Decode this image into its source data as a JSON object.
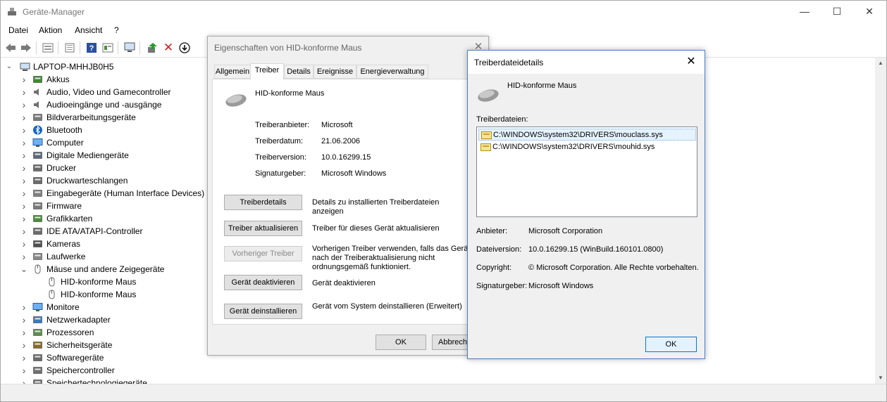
{
  "main": {
    "title": "Geräte-Manager",
    "menu": [
      "Datei",
      "Aktion",
      "Ansicht",
      "?"
    ],
    "window_buttons": {
      "minimize": "—",
      "maximize": "☐",
      "close": "✕"
    },
    "tree": {
      "root": "LAPTOP-MHHJB0H5",
      "items": [
        {
          "label": "Akkus",
          "icon": "battery-icon",
          "expanded": false
        },
        {
          "label": "Audio, Video und Gamecontroller",
          "icon": "speaker-icon",
          "expanded": false
        },
        {
          "label": "Audioeingänge und -ausgänge",
          "icon": "speaker-icon",
          "expanded": false
        },
        {
          "label": "Bildverarbeitungsgeräte",
          "icon": "camera-icon",
          "expanded": false
        },
        {
          "label": "Bluetooth",
          "icon": "bluetooth-icon",
          "expanded": false
        },
        {
          "label": "Computer",
          "icon": "monitor-icon",
          "expanded": false
        },
        {
          "label": "Digitale Mediengeräte",
          "icon": "media-icon",
          "expanded": false
        },
        {
          "label": "Drucker",
          "icon": "printer-icon",
          "expanded": false
        },
        {
          "label": "Druckwarteschlangen",
          "icon": "printer-icon",
          "expanded": false
        },
        {
          "label": "Eingabegeräte (Human Interface Devices)",
          "icon": "hid-icon",
          "expanded": false
        },
        {
          "label": "Firmware",
          "icon": "chip-icon",
          "expanded": false
        },
        {
          "label": "Grafikkarten",
          "icon": "display-adapter-icon",
          "expanded": false
        },
        {
          "label": "IDE ATA/ATAPI-Controller",
          "icon": "controller-icon",
          "expanded": false
        },
        {
          "label": "Kameras",
          "icon": "webcam-icon",
          "expanded": false
        },
        {
          "label": "Laufwerke",
          "icon": "drive-icon",
          "expanded": false
        },
        {
          "label": "Mäuse und andere Zeigegeräte",
          "icon": "mouse-icon",
          "expanded": true
        },
        {
          "label": "HID-konforme Maus",
          "icon": "mouse-icon",
          "child": true
        },
        {
          "label": "HID-konforme Maus",
          "icon": "mouse-icon",
          "child": true
        },
        {
          "label": "Monitore",
          "icon": "monitor-icon",
          "expanded": false
        },
        {
          "label": "Netzwerkadapter",
          "icon": "network-icon",
          "expanded": false
        },
        {
          "label": "Prozessoren",
          "icon": "cpu-icon",
          "expanded": false
        },
        {
          "label": "Sicherheitsgeräte",
          "icon": "security-icon",
          "expanded": false
        },
        {
          "label": "Softwaregeräte",
          "icon": "software-icon",
          "expanded": false
        },
        {
          "label": "Speichercontroller",
          "icon": "storage-icon",
          "expanded": false
        },
        {
          "label": "Speichertechnologiegeräte",
          "icon": "storage-icon",
          "expanded": false
        }
      ]
    }
  },
  "properties": {
    "title": "Eigenschaften von HID-konforme Maus",
    "tabs": [
      "Allgemein",
      "Treiber",
      "Details",
      "Ereignisse",
      "Energieverwaltung"
    ],
    "active_tab": "Treiber",
    "device_name": "HID-konforme Maus",
    "fields": [
      {
        "label": "Treiberanbieter:",
        "value": "Microsoft"
      },
      {
        "label": "Treiberdatum:",
        "value": "21.06.2006"
      },
      {
        "label": "Treiberversion:",
        "value": "10.0.16299.15"
      },
      {
        "label": "Signaturgeber:",
        "value": "Microsoft Windows"
      }
    ],
    "actions": [
      {
        "button": "Treiberdetails",
        "desc": "Details zu installierten Treiberdateien anzeigen",
        "enabled": true
      },
      {
        "button": "Treiber aktualisieren",
        "desc": "Treiber für dieses Gerät aktualisieren",
        "enabled": true
      },
      {
        "button": "Vorheriger Treiber",
        "desc_lines": [
          "Vorherigen Treiber verwenden, falls das Gerät",
          "nach der Treiberaktualisierung nicht",
          "ordnungsgemäß funktioniert."
        ],
        "enabled": false
      },
      {
        "button": "Gerät deaktivieren",
        "desc": "Gerät deaktivieren",
        "enabled": true
      },
      {
        "button": "Gerät deinstallieren",
        "desc": "Gerät vom System deinstallieren (Erweitert)",
        "enabled": true
      }
    ],
    "ok_label": "OK",
    "cancel_label": "Abbrech"
  },
  "details": {
    "title": "Treiberdateidetails",
    "device_name": "HID-konforme Maus",
    "files_label": "Treiberdateien:",
    "files": [
      "C:\\WINDOWS\\system32\\DRIVERS\\mouclass.sys",
      "C:\\WINDOWS\\system32\\DRIVERS\\mouhid.sys"
    ],
    "selected_file_index": 0,
    "info": [
      {
        "label": "Anbieter:",
        "value": "Microsoft Corporation"
      },
      {
        "label": "Dateiversion:",
        "value": "10.0.16299.15 (WinBuild.160101.0800)"
      },
      {
        "label": "Copyright:",
        "value": "© Microsoft Corporation. Alle Rechte vorbehalten."
      },
      {
        "label": "Signaturgeber:",
        "value": "Microsoft Windows"
      }
    ],
    "ok_label": "OK"
  },
  "colors": {
    "accent": "#0078d7",
    "selection": "#e5f3ff",
    "dialog_bg": "#f0f0f0"
  }
}
